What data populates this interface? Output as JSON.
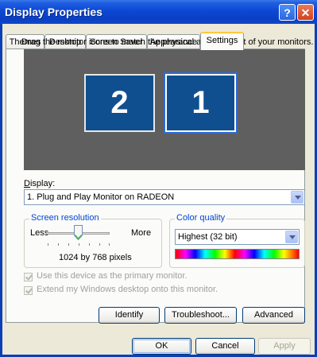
{
  "window": {
    "title": "Display Properties",
    "help_glyph": "?",
    "close_glyph": "✕"
  },
  "tabs": [
    {
      "label": "Themes",
      "active": false
    },
    {
      "label": "Desktop",
      "active": false
    },
    {
      "label": "Screen Saver",
      "active": false
    },
    {
      "label": "Appearance",
      "active": false
    },
    {
      "label": "Settings",
      "active": true
    }
  ],
  "settings": {
    "instruction": "Drag the monitor icons to match the physical arrangement of your monitors.",
    "monitors": [
      {
        "number": "2",
        "selected": false
      },
      {
        "number": "1",
        "selected": true
      }
    ],
    "display_label": "Display:",
    "display_value": "1. Plug and Play Monitor on RADEON",
    "resolution": {
      "group_title": "Screen resolution",
      "less": "Less",
      "more": "More",
      "value_text": "1024 by 768 pixels",
      "slider_position_fraction": 0.5
    },
    "color_quality": {
      "group_title": "Color quality",
      "value": "Highest (32 bit)"
    },
    "primary_checkbox": {
      "label": "Use this device as the primary monitor.",
      "checked": true,
      "enabled": false
    },
    "extend_checkbox": {
      "label": "Extend my Windows desktop onto this monitor.",
      "checked": true,
      "enabled": false
    },
    "buttons": {
      "identify": "Identify",
      "troubleshoot": "Troubleshoot...",
      "advanced": "Advanced"
    }
  },
  "dialog_buttons": {
    "ok": "OK",
    "cancel": "Cancel",
    "apply": "Apply"
  },
  "colors": {
    "titlebar": "#0a3fc4",
    "monitor_fill": "#0f4f8f",
    "monitor_area": "#5f5f5f",
    "group_title": "#0046d5"
  }
}
